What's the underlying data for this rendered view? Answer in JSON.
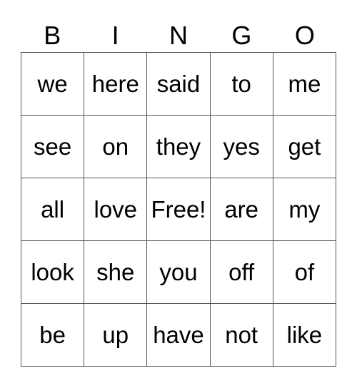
{
  "header": [
    "B",
    "I",
    "N",
    "G",
    "O"
  ],
  "rows": [
    [
      "we",
      "here",
      "said",
      "to",
      "me"
    ],
    [
      "see",
      "on",
      "they",
      "yes",
      "get"
    ],
    [
      "all",
      "love",
      "Free!",
      "are",
      "my"
    ],
    [
      "look",
      "she",
      "you",
      "off",
      "of"
    ],
    [
      "be",
      "up",
      "have",
      "not",
      "like"
    ]
  ]
}
